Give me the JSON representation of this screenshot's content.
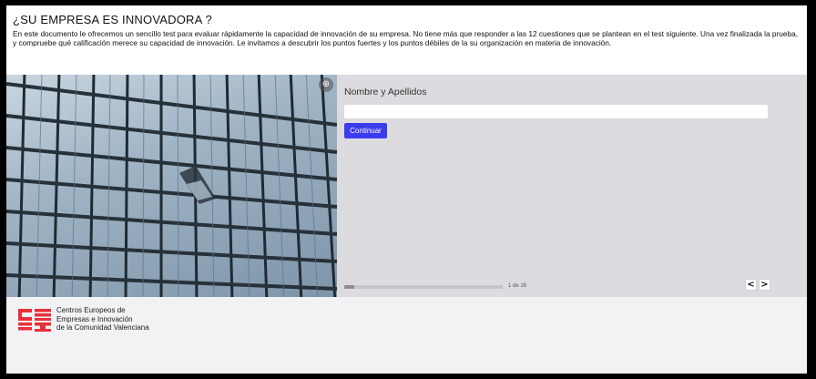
{
  "header": {
    "title": "¿SU EMPRESA ES INNOVADORA ?",
    "intro": "En este documento le ofrecemos un sencillo test para evaluar rápidamente la capacidad de innovación de su empresa. No tiene más que responder a las 12 cuestiones que se plantean en el test siguiente. Una vez finalizada la prueba, y compruebe qué calificación merece su capacidad de innovación. Le invitamos a descubrir los puntos fuertes y los puntos débiles de la su organización en materia de innovación."
  },
  "photo": {
    "description_icon": "zoom-icon"
  },
  "form": {
    "field_label": "Nombre y Apellidos",
    "name_value": "",
    "name_placeholder": "",
    "continue_label": "Continuar"
  },
  "pagination": {
    "current": 1,
    "total": 16,
    "label": "1 de 16",
    "prev_label": "<",
    "next_label": ">"
  },
  "footer": {
    "logo_lines": [
      "Centros Europeos de",
      "Empresas e Innovación",
      "de la Comunidad Valenciana"
    ],
    "logo_color": "#e8303a"
  },
  "colors": {
    "accent": "#3b3bf0",
    "panel": "#dcdce0",
    "background": "#f2f2f5"
  }
}
